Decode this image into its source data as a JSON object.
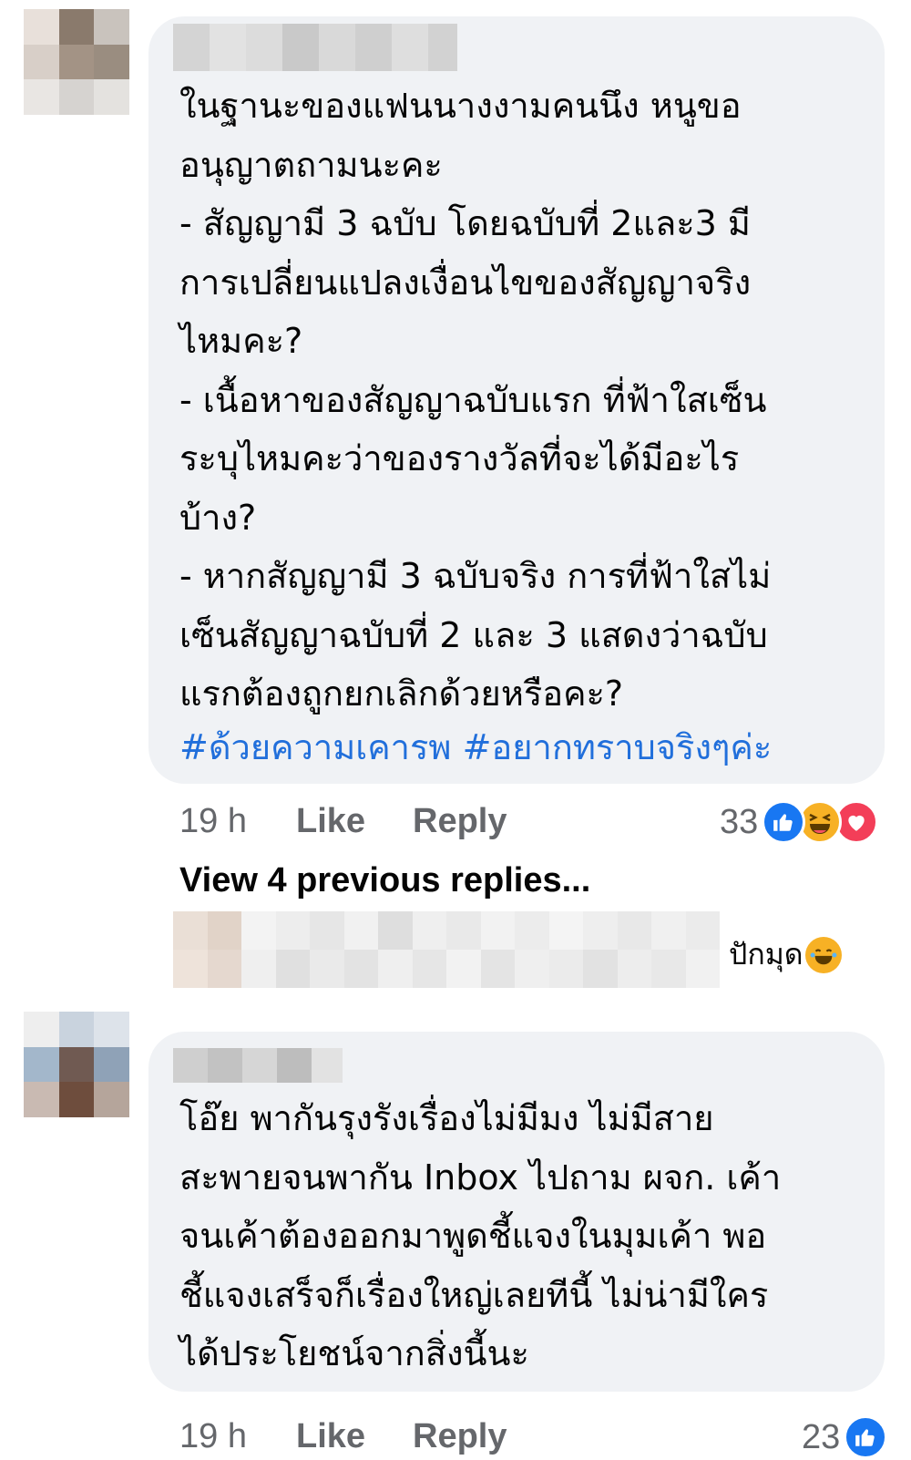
{
  "comment1": {
    "text": "ในฐานะของแฟนนางงามคนนึง หนูขอ\nอนุญาตถามนะคะ\n- สัญญามี 3 ฉบับ โดยฉบับที่ 2และ3 มี\nการเปลี่ยนแปลงเงื่อนไขของสัญญาจริง\nไหมคะ?\n- เนื้อหาของสัญญาฉบับแรก ที่ฟ้าใสเซ็น\nระบุไหมคะว่าของรางวัลที่จะได้มีอะไร\nบ้าง?\n- หากสัญญามี 3 ฉบับจริง การที่ฟ้าใสไม่\nเซ็นสัญญาฉบับที่ 2 และ 3 แสดงว่าฉบับ\nแรกต้องถูกยกเลิกด้วยหรือคะ?",
    "hashtag1": "#ด้วยความเคารพ",
    "hashtag2": "#อยากทราบจริงๆค่ะ",
    "time": "19 h",
    "like_label": "Like",
    "reply_label": "Reply",
    "reaction_count": "33",
    "reactions": [
      "like-icon",
      "haha-icon",
      "love-icon"
    ]
  },
  "view_previous_replies": "View 4 previous replies...",
  "reply_preview": {
    "text": "ปักมุด",
    "emoji": "😂"
  },
  "comment2": {
    "text": "โอ๊ย พากันรุงรังเรื่องไม่มีมง ไม่มีสาย\nสะพายจนพากัน Inbox ไปถาม ผจก. เค้า\nจนเค้าต้องออกมาพูดชี้แจงในมุมเค้า พอ\nชี้แจงเสร็จก็เรื่องใหญ่เลยทีนี้ ไม่น่ามีใคร\nได้ประโยชน์จากสิ่งนี้นะ",
    "time": "19 h",
    "like_label": "Like",
    "reply_label": "Reply",
    "reaction_count": "23",
    "reactions": [
      "like-icon"
    ]
  },
  "colors": {
    "bubble": "#f0f2f5",
    "link": "#216fdb",
    "secondary_text": "#65676b",
    "like_blue": "#1877f2",
    "love_red": "#f33e58",
    "haha_yellow": "#f7b125"
  }
}
